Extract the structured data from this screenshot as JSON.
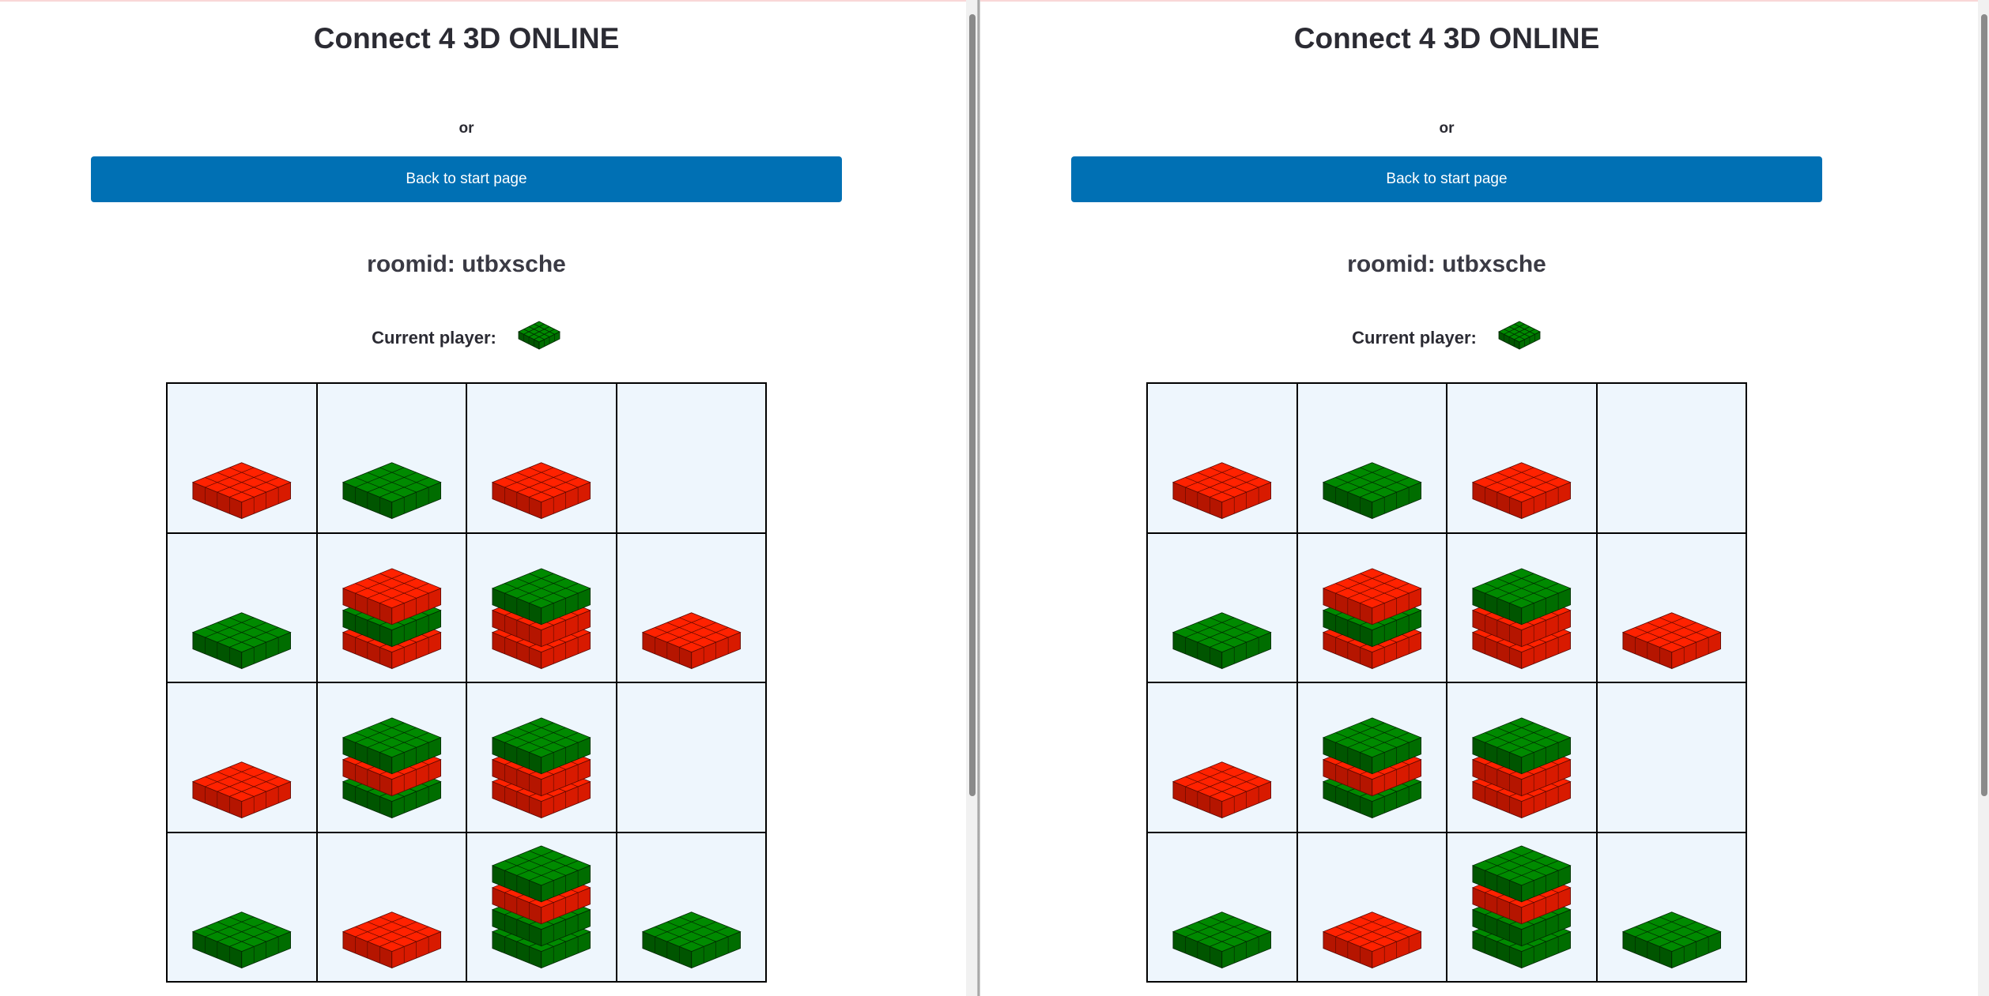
{
  "app": {
    "title": "Connect 4 3D ONLINE",
    "or_text": "or",
    "back_button": "Back to start page",
    "roomid_label": "roomid: utbxsche",
    "current_player_label": "Current player:",
    "current_player_color": "green"
  },
  "colors": {
    "red": {
      "top": "#ff2200",
      "left": "#b51500",
      "right": "#d81a00",
      "line": "#5a0800"
    },
    "green": {
      "top": "#008a00",
      "left": "#005500",
      "right": "#006d00",
      "line": "#002700"
    },
    "button": "#0070b4",
    "cell_bg": "#eef6fd"
  },
  "board": {
    "rows": 4,
    "cols": 4,
    "stacks": [
      [
        [
          "red"
        ],
        [
          "green"
        ],
        [
          "red"
        ],
        []
      ],
      [
        [
          "green"
        ],
        [
          "red",
          "green",
          "red"
        ],
        [
          "red",
          "red",
          "green"
        ],
        [
          "red"
        ]
      ],
      [
        [
          "red"
        ],
        [
          "green",
          "red",
          "green"
        ],
        [
          "red",
          "red",
          "green"
        ],
        []
      ],
      [
        [
          "green"
        ],
        [
          "red"
        ],
        [
          "green",
          "green",
          "red",
          "green"
        ],
        [
          "green"
        ]
      ]
    ]
  }
}
